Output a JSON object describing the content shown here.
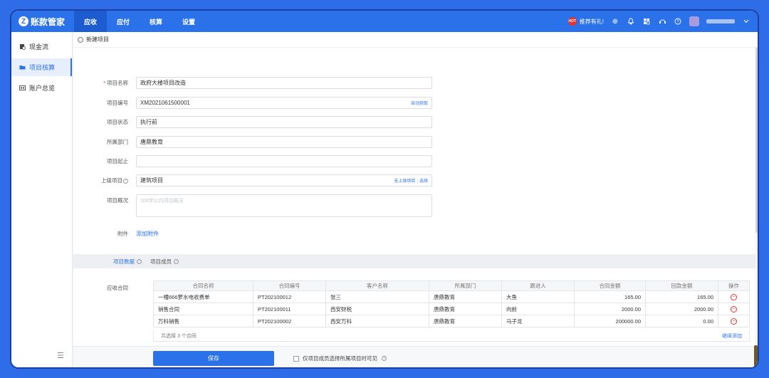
{
  "app": {
    "logo_letter": "Z",
    "name": "账款管家"
  },
  "nav": [
    {
      "label": "应收",
      "active": true
    },
    {
      "label": "应付",
      "active": false
    },
    {
      "label": "核算",
      "active": false
    },
    {
      "label": "设置",
      "active": false
    }
  ],
  "topbar": {
    "hot_badge": "HOT",
    "promo": "推荐有礼!",
    "icons": [
      "plus-circle-icon",
      "bell-icon",
      "apps-icon",
      "headset-icon",
      "help-icon"
    ]
  },
  "sidebar": {
    "items": [
      {
        "label": "现金流",
        "icon": "cashflow-icon",
        "active": false
      },
      {
        "label": "项目核算",
        "icon": "folder-icon",
        "active": true
      },
      {
        "label": "账户总览",
        "icon": "account-icon",
        "active": false
      }
    ]
  },
  "breadcrumb": {
    "label": "新建项目"
  },
  "form": {
    "name": {
      "label": "项目名称",
      "value": "政府大楼项目改造"
    },
    "code": {
      "label": "项目编号",
      "value": "XM2021061500001",
      "action": "自动获取"
    },
    "status": {
      "label": "项目状态",
      "value": "执行前"
    },
    "dept": {
      "label": "所属部门",
      "value": "唐鼎教育"
    },
    "period": {
      "label": "项目起止",
      "value": ""
    },
    "parent": {
      "label": "上级项目",
      "value": "建筑项目",
      "action_none": "无上级项目",
      "action_select": "选择"
    },
    "overview": {
      "label": "项目概况",
      "placeholder": "100字以内项目概况"
    },
    "attachment": {
      "label": "附件",
      "link": "添加附件"
    }
  },
  "tabs": [
    {
      "label": "项目数据",
      "active": true
    },
    {
      "label": "项目成员",
      "active": false
    }
  ],
  "contracts": {
    "label": "应收合同",
    "columns": [
      "合同名称",
      "合同编号",
      "客户名称",
      "所属部门",
      "跟进人",
      "合同金额",
      "回款金额",
      "操作"
    ],
    "rows": [
      [
        "一幢666萝水电收费单",
        "PT202100012",
        "张三",
        "唐鼎教育",
        "大鱼",
        "165.00",
        "165.00"
      ],
      [
        "销售合同",
        "PT202100011",
        "西安财税",
        "唐鼎教育",
        "向前",
        "2000.00",
        "2000.00"
      ],
      [
        "万科销售",
        "PT202100002",
        "西安万科",
        "唐鼎教育",
        "马子龙",
        "200000.00",
        "0.00"
      ]
    ],
    "summary": "共选择 3 个合同",
    "add_more": "继续添加"
  },
  "footer": {
    "save": "保存",
    "visibility_option": "仅项目成员选择所属项目时可见"
  }
}
